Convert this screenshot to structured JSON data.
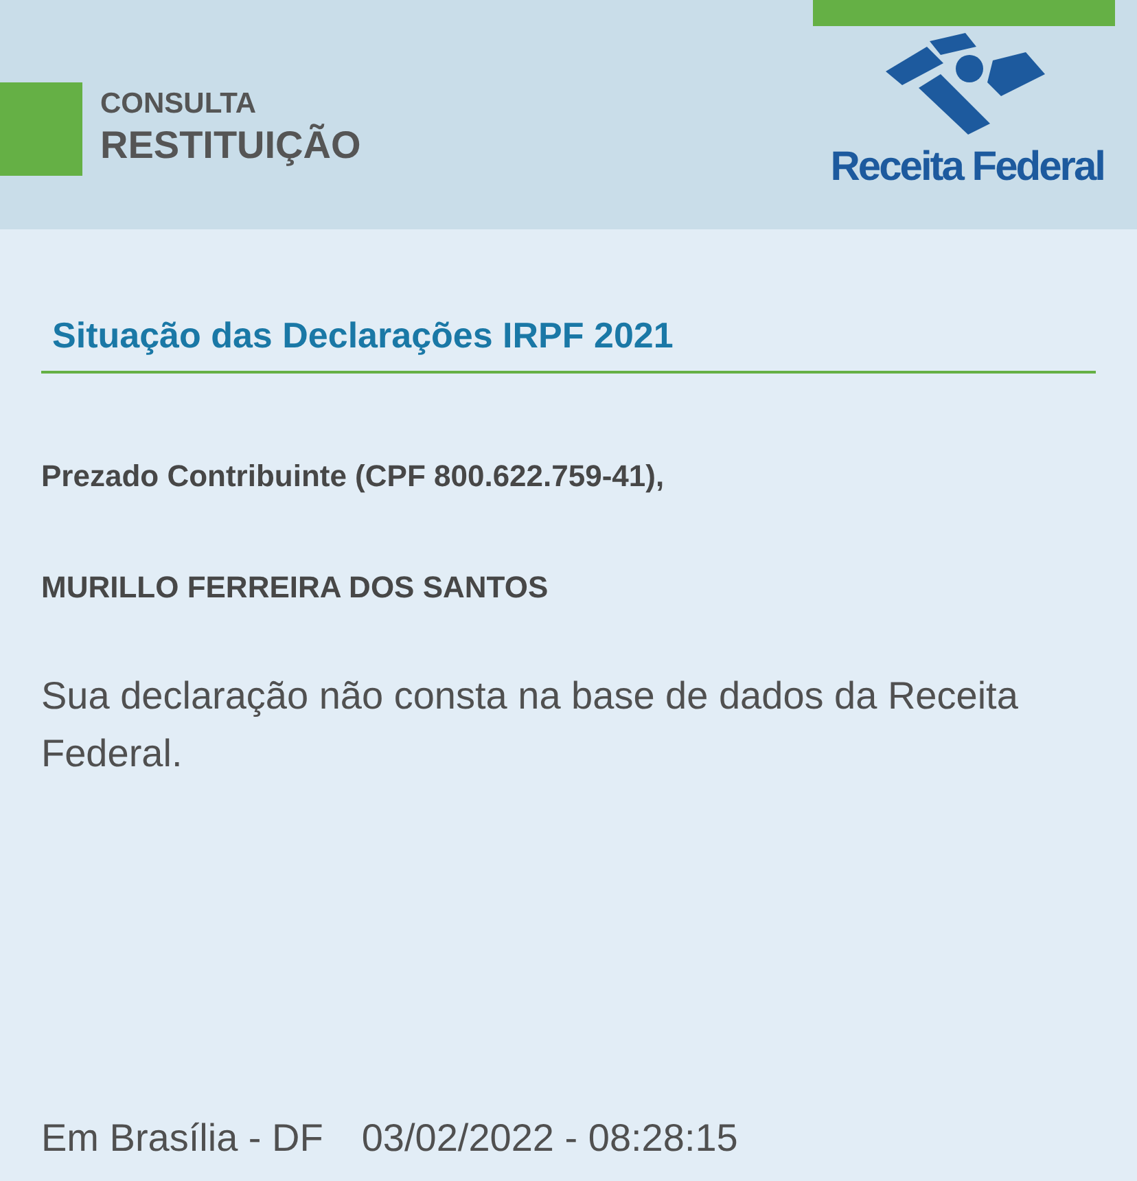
{
  "header": {
    "kicker": "CONSULTA",
    "title": "RESTITUIÇÃO",
    "logo_text": "Receita Federal"
  },
  "section_title": "Situação das Declarações IRPF 2021",
  "greeting": "Prezado Contribuinte (CPF 800.622.759-41),",
  "taxpayer_name": "MURILLO FERREIRA DOS SANTOS",
  "message": "Sua declaração não consta na base de dados da Receita Federal.",
  "footer": {
    "place": "Em Brasília - DF",
    "timestamp": "03/02/2022 - 08:28:15"
  }
}
